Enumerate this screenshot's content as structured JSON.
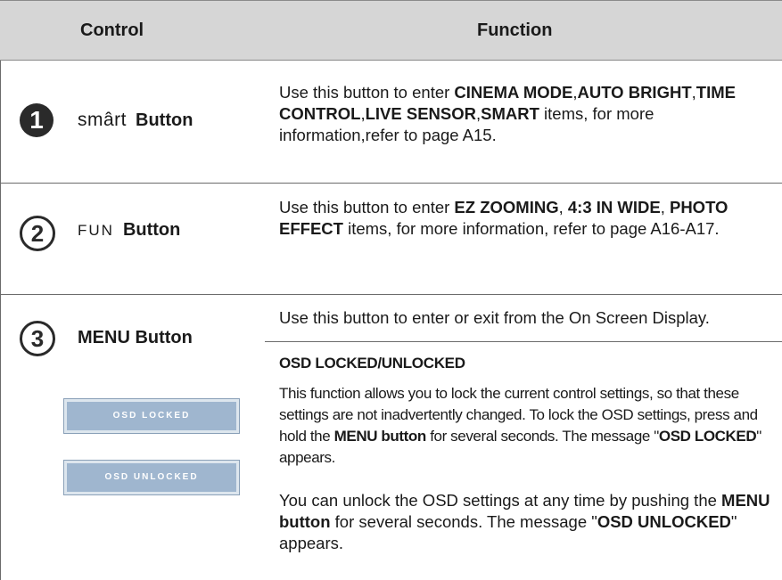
{
  "header": {
    "control": "Control",
    "function": "Function"
  },
  "rows": [
    {
      "number": "1",
      "logo": "smârt",
      "label": "Button",
      "function": {
        "t1": "Use this button to enter ",
        "b1": "CINEMA MODE",
        "t2": ",",
        "b2": "AUTO BRIGHT",
        "t3": ",",
        "b3": "TIME CONTROL",
        "t4": ",",
        "b4": "LIVE SENSOR",
        "t5": ",",
        "b5": "SMART",
        "t6": " items, for more information,refer to page A15."
      }
    },
    {
      "number": "2",
      "logo": "FUN",
      "label": "Button",
      "function": {
        "t1": "Use this button to enter ",
        "b1": "EZ ZOOMING",
        "t2": ", ",
        "b2": "4:3 IN WIDE",
        "t3": ", ",
        "b3": "PHOTO EFFECT",
        "t4": " items, for more information, refer to page A16-A17."
      }
    },
    {
      "number": "3",
      "label": "MENU Button",
      "function_line": "Use this button to enter or exit from the On Screen Display.",
      "osd_locked_label": "OSD LOCKED",
      "osd_unlocked_label": "OSD UNLOCKED",
      "osd_title": "OSD LOCKED/UNLOCKED",
      "p1": {
        "t1": "This function allows you to lock the current control settings, so that these settings are not inadvertently changed. To lock the OSD settings, press and hold the ",
        "b1": "MENU button",
        "t2": " for several seconds. The message \"",
        "b2": "OSD LOCKED",
        "t3": "\" appears."
      },
      "p2": {
        "t1": "You can unlock the OSD settings at any time by pushing the ",
        "b1": "MENU button",
        "t2": " for several seconds. The message \"",
        "b2": "OSD UNLOCKED",
        "t3": "\" appears."
      }
    }
  ]
}
